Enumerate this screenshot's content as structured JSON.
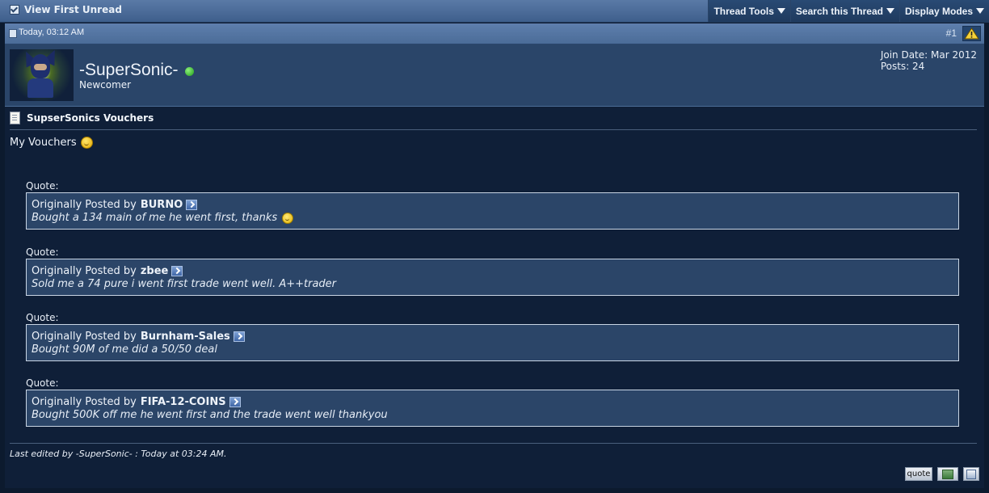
{
  "toolbar": {
    "view_first_unread": "View First Unread",
    "thread_tools": "Thread Tools",
    "search_thread": "Search this Thread",
    "display_modes": "Display Modes"
  },
  "post_header": {
    "date": "Today, 03:12 AM",
    "post_number": "#1"
  },
  "user": {
    "name": "-SuperSonic-",
    "title": "Newcomer",
    "join_date": "Join Date: Mar 2012",
    "posts": "Posts: 24",
    "online_status_color": "#2fbf23"
  },
  "post": {
    "title": "SupserSonics Vouchers",
    "message": "My Vouchers",
    "quotes": [
      {
        "label": "Quote:",
        "prefix": "Originally Posted by",
        "author": "BURNO",
        "text": "Bought a 134 main of me he went first, thanks"
      },
      {
        "label": "Quote:",
        "prefix": "Originally Posted by",
        "author": "zbee",
        "text": "Sold me a 74 pure i went first trade went well. A++trader"
      },
      {
        "label": "Quote:",
        "prefix": "Originally Posted by",
        "author": "Burnham-Sales",
        "text": "Bought 90M of me did a 50/50 deal"
      },
      {
        "label": "Quote:",
        "prefix": "Originally Posted by",
        "author": "FIFA-12-COINS",
        "text": "Bought 500K off me he went first and the trade went well thankyou"
      }
    ],
    "edited": "Last edited by -SuperSonic- : Today at 03:24 AM."
  },
  "buttons": {
    "quote": "quote"
  },
  "colors": {
    "background": "#0c1a2e",
    "header_blue": "#4b6c98",
    "quote_box": "#2b4568"
  }
}
